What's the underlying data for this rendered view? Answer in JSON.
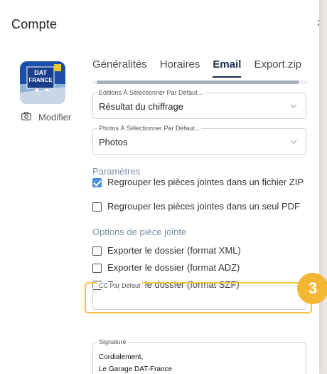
{
  "dialog": {
    "title": "Compte"
  },
  "profile": {
    "logo_text_top": "DAT",
    "logo_text_bottom": "FRANCE",
    "modify_label": "Modifier"
  },
  "tabs": [
    {
      "label": "Généralités",
      "active": false
    },
    {
      "label": "Horaires",
      "active": false
    },
    {
      "label": "Email",
      "active": true
    },
    {
      "label": "Export.zip",
      "active": false
    }
  ],
  "fields": {
    "editions": {
      "legend": "Editions À Sélectionner Par Défaut...",
      "value": "Résultat du chiffrage"
    },
    "photos": {
      "legend": "Photos À Sélectionner Par Défaut...",
      "value": "Photos"
    },
    "cc": {
      "legend": "CC Par Défaut",
      "value": ""
    },
    "signature": {
      "legend": "Signature",
      "line1": "Cordialement,",
      "line2": "Le Garage DAT-France"
    }
  },
  "parametres": {
    "title": "Paramètres",
    "options": [
      {
        "label": "Regrouper les pièces jointes dans un fichier ZIP",
        "checked": true
      },
      {
        "label": "Regrouper les pièces jointes dans un seul PDF",
        "checked": false
      }
    ]
  },
  "piece_jointe": {
    "title": "Options de pièce jointe",
    "options": [
      {
        "label": "Exporter le dossier (format XML)",
        "checked": false
      },
      {
        "label": "Exporter le dossier (format ADZ)",
        "checked": false
      },
      {
        "label": "Exporter le dossier (format SZF)",
        "checked": false
      }
    ]
  },
  "step_badge": "3",
  "colors": {
    "accent": "#4a90d9",
    "active_tab": "#1a2b4a",
    "highlight": "#f2c24b",
    "badge": "#f4b733"
  }
}
